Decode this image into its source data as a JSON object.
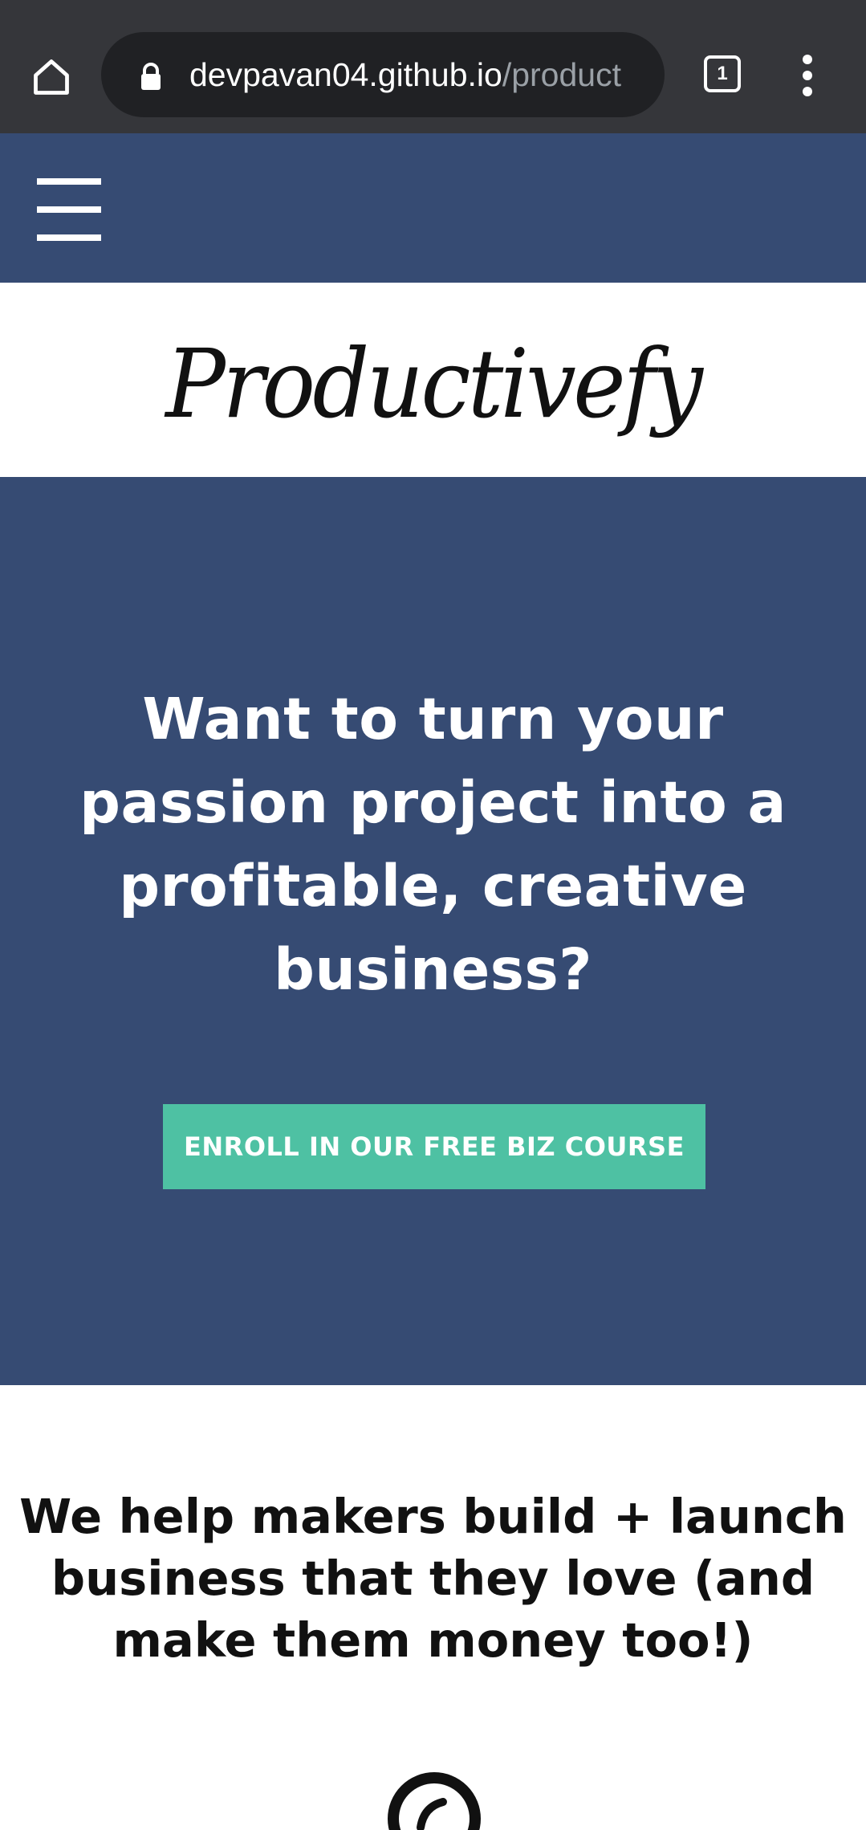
{
  "browser": {
    "url_host": "devpavan04.github.io",
    "url_path": "/product",
    "tab_count": "1",
    "icons": [
      "home-icon",
      "lock-icon",
      "tabs-icon",
      "more-vert-icon"
    ]
  },
  "nav": {
    "menu_icon": "hamburger-icon"
  },
  "logo": {
    "text": "Productivefy"
  },
  "hero": {
    "title": "Want to turn your passion project into a profitable, creative business?",
    "cta_label": "ENROLL IN OUR FREE BIZ COURSE"
  },
  "tagline": {
    "text": "We help makers build + launch business that they love (and make them money too!)"
  },
  "colors": {
    "browser_bar": "#35363a",
    "nav_bg": "#364b73",
    "hero_bg": "#364b73",
    "cta_bg": "#4ec1a3",
    "text_dark": "#111111"
  },
  "bottom_icon": "circle-icon"
}
